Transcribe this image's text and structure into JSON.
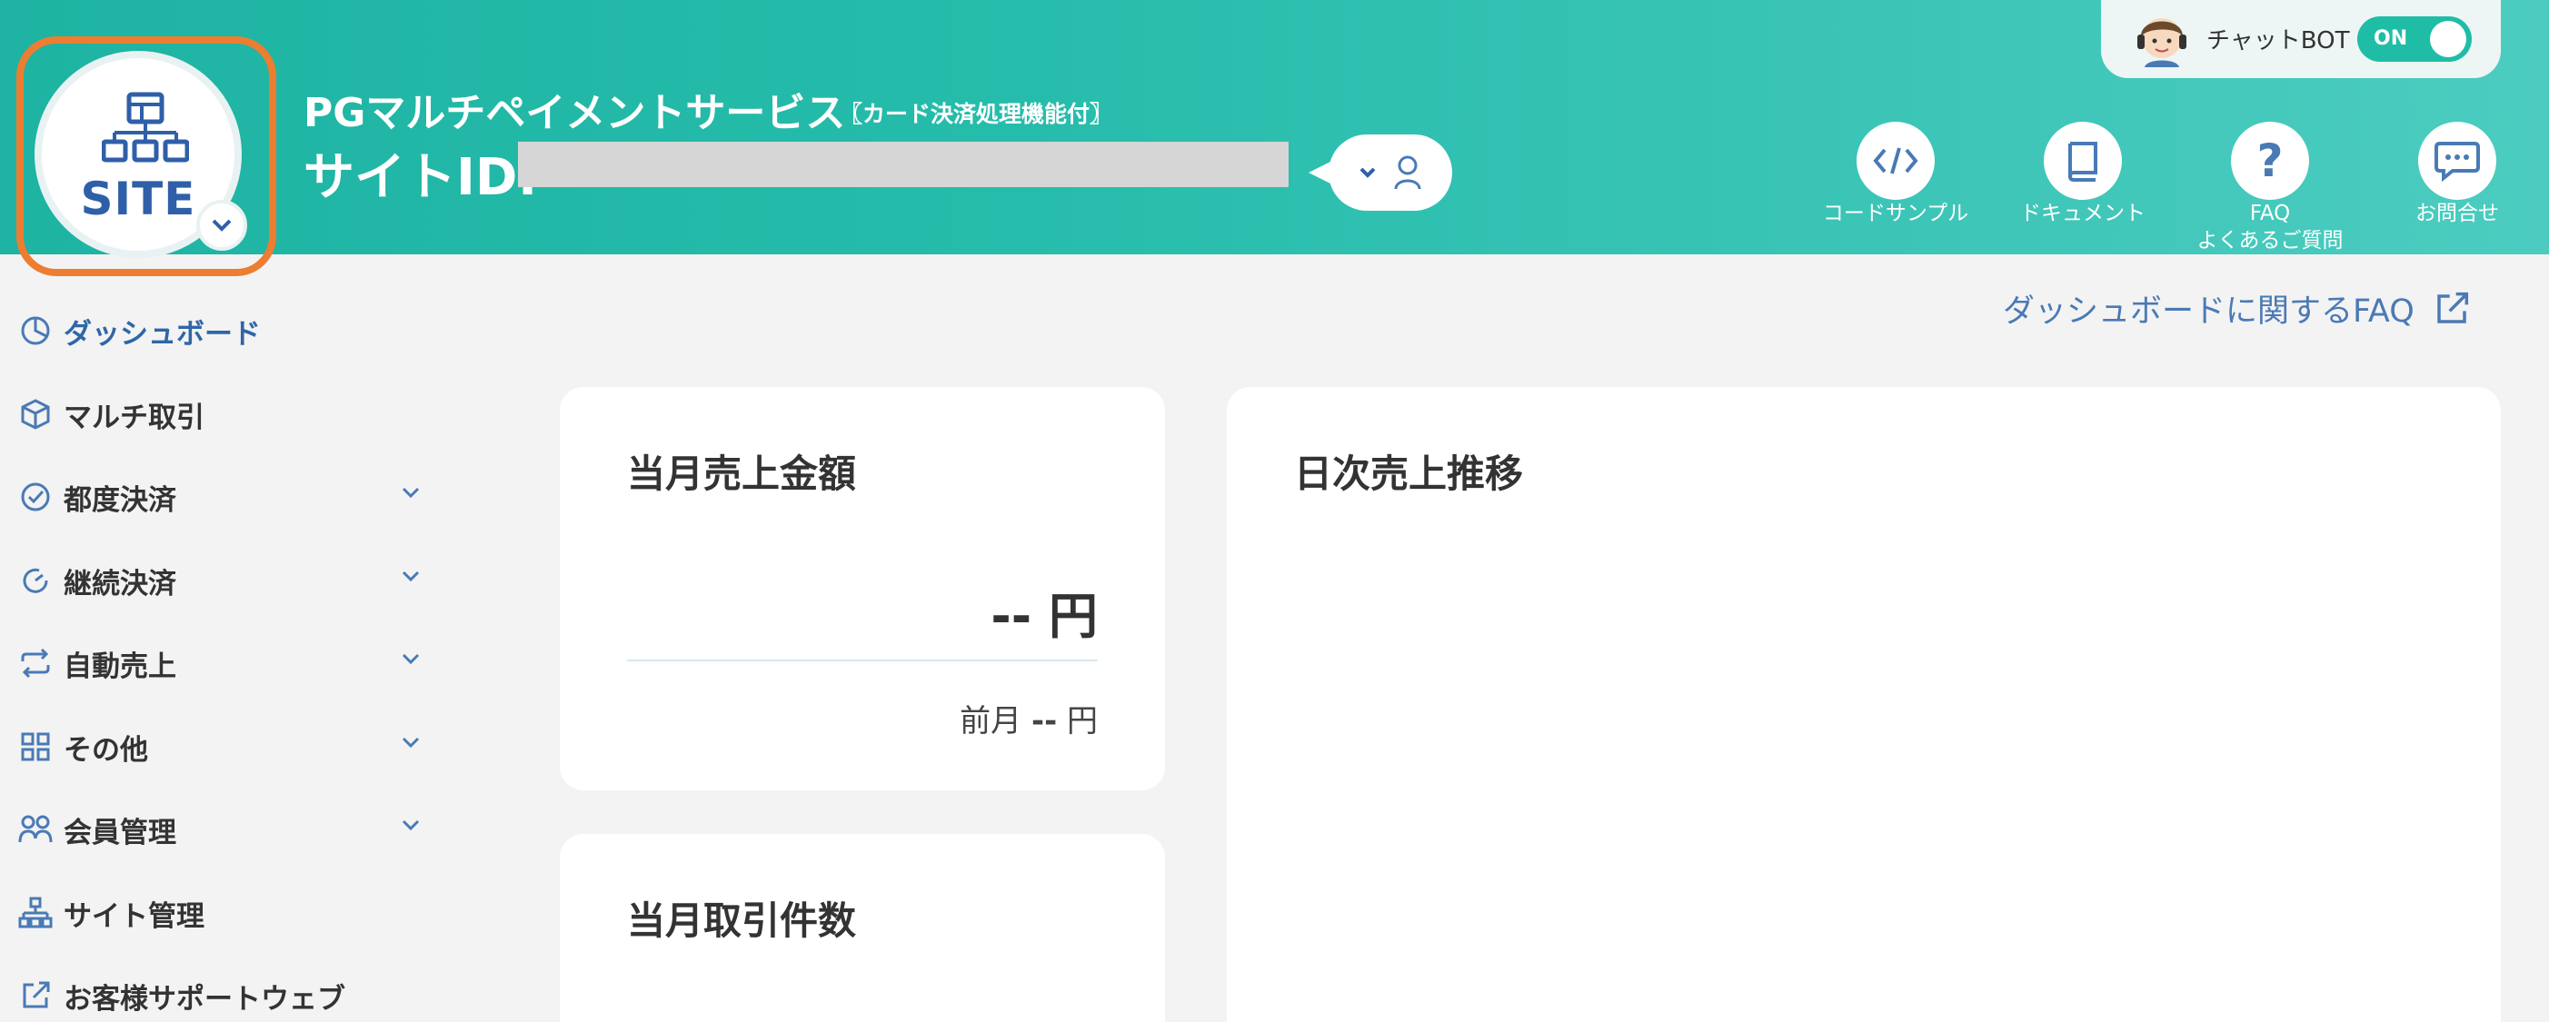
{
  "header": {
    "site_label": "SITE",
    "service_title": "PGマルチペイメントサービス",
    "service_subtitle": "〖カード決済処理機能付〗",
    "site_id_label": "サイトID:",
    "chatbot": {
      "label": "チャットBOT",
      "toggle": "ON"
    },
    "nav": [
      {
        "icon": "code-icon",
        "label": "コードサンプル"
      },
      {
        "icon": "document-icon",
        "label": "ドキュメント"
      },
      {
        "icon": "question-icon",
        "label": "FAQ",
        "label2": "よくあるご質問"
      },
      {
        "icon": "chat-icon",
        "label": "お問合せ"
      }
    ]
  },
  "sidebar": {
    "items": [
      {
        "label": "ダッシュボード",
        "icon": "pie-chart-icon",
        "active": true
      },
      {
        "label": "マルチ取引",
        "icon": "box-icon"
      },
      {
        "label": "都度決済",
        "icon": "check-circle-icon",
        "expandable": true
      },
      {
        "label": "継続決済",
        "icon": "refresh-circle-icon",
        "expandable": true
      },
      {
        "label": "自動売上",
        "icon": "repeat-icon",
        "expandable": true
      },
      {
        "label": "その他",
        "icon": "grid-icon",
        "expandable": true
      },
      {
        "label": "会員管理",
        "icon": "users-icon",
        "expandable": true
      },
      {
        "label": "サイト管理",
        "icon": "sitemap-icon"
      },
      {
        "label": "お客様サポートウェブ",
        "icon": "external-link-icon"
      }
    ]
  },
  "main": {
    "faq_link": "ダッシュボードに関するFAQ",
    "monthly_sales": {
      "title": "当月売上金額",
      "value": "-- 円",
      "prev_label": "前月",
      "prev_value": "--",
      "prev_unit": "円"
    },
    "monthly_count": {
      "title": "当月取引件数"
    },
    "daily_trend": {
      "title": "日次売上推移"
    }
  },
  "colors": {
    "header_start": "#1eb3a2",
    "header_end": "#4cccc0",
    "accent_orange": "#ed7d31",
    "link_blue": "#4a7ab5",
    "toggle_green": "#1fbda6"
  }
}
